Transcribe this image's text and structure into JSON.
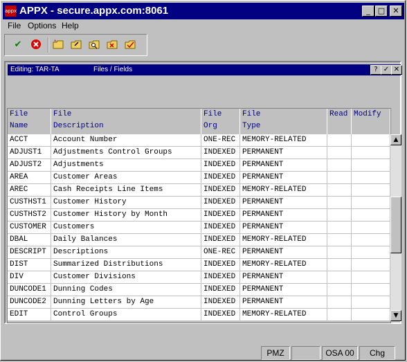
{
  "window": {
    "title": "APPX - secure.appx.com:8061",
    "icon_label": "appx",
    "buttons": [
      "_",
      "□",
      "✕"
    ]
  },
  "menu": [
    "File",
    "Options",
    "Help"
  ],
  "toolbar": {
    "icons": [
      "confirm-icon",
      "cancel-icon",
      "new-folder-icon",
      "edit-folder-icon",
      "search-folder-icon",
      "delete-folder-icon",
      "check-folder-icon"
    ]
  },
  "inner": {
    "editing": "Editing: TAR-TA",
    "section": "Files / Fields",
    "buttons": [
      "?",
      "✓",
      "✕"
    ]
  },
  "table": {
    "headers": [
      [
        "File",
        "Name"
      ],
      [
        "File",
        "Description"
      ],
      [
        "File",
        "Org"
      ],
      [
        "File",
        "Type"
      ],
      [
        "",
        "Read"
      ],
      [
        "",
        "Modify"
      ]
    ],
    "rows": [
      [
        "ACCT",
        "Account Number",
        "ONE-REC",
        "MEMORY-RELATED"
      ],
      [
        "ADJUST1",
        "Adjustments Control Groups",
        "INDEXED",
        "PERMANENT"
      ],
      [
        "ADJUST2",
        "Adjustments",
        "INDEXED",
        "PERMANENT"
      ],
      [
        "AREA",
        "Customer Areas",
        "INDEXED",
        "PERMANENT"
      ],
      [
        "AREC",
        "Cash Receipts Line Items",
        "INDEXED",
        "MEMORY-RELATED"
      ],
      [
        "CUSTHST1",
        "Customer History",
        "INDEXED",
        "PERMANENT"
      ],
      [
        "CUSTHST2",
        "Customer History by Month",
        "INDEXED",
        "PERMANENT"
      ],
      [
        "CUSTOMER",
        "Customers",
        "INDEXED",
        "PERMANENT"
      ],
      [
        "DBAL",
        "Daily Balances",
        "INDEXED",
        "MEMORY-RELATED"
      ],
      [
        "DESCRIPT",
        "Descriptions",
        "ONE-REC",
        "PERMANENT"
      ],
      [
        "DIST",
        "Summarized Distributions",
        "INDEXED",
        "MEMORY-RELATED"
      ],
      [
        "DIV",
        "Customer Divisions",
        "INDEXED",
        "PERMANENT"
      ],
      [
        "DUNCODE1",
        "Dunning Codes",
        "INDEXED",
        "PERMANENT"
      ],
      [
        "DUNCODE2",
        "Dunning Letters by Age",
        "INDEXED",
        "PERMANENT"
      ],
      [
        "EDIT",
        "Control Groups",
        "INDEXED",
        "MEMORY-RELATED"
      ]
    ]
  },
  "status": [
    "PMZ",
    "",
    "OSA 00",
    "Chg"
  ]
}
